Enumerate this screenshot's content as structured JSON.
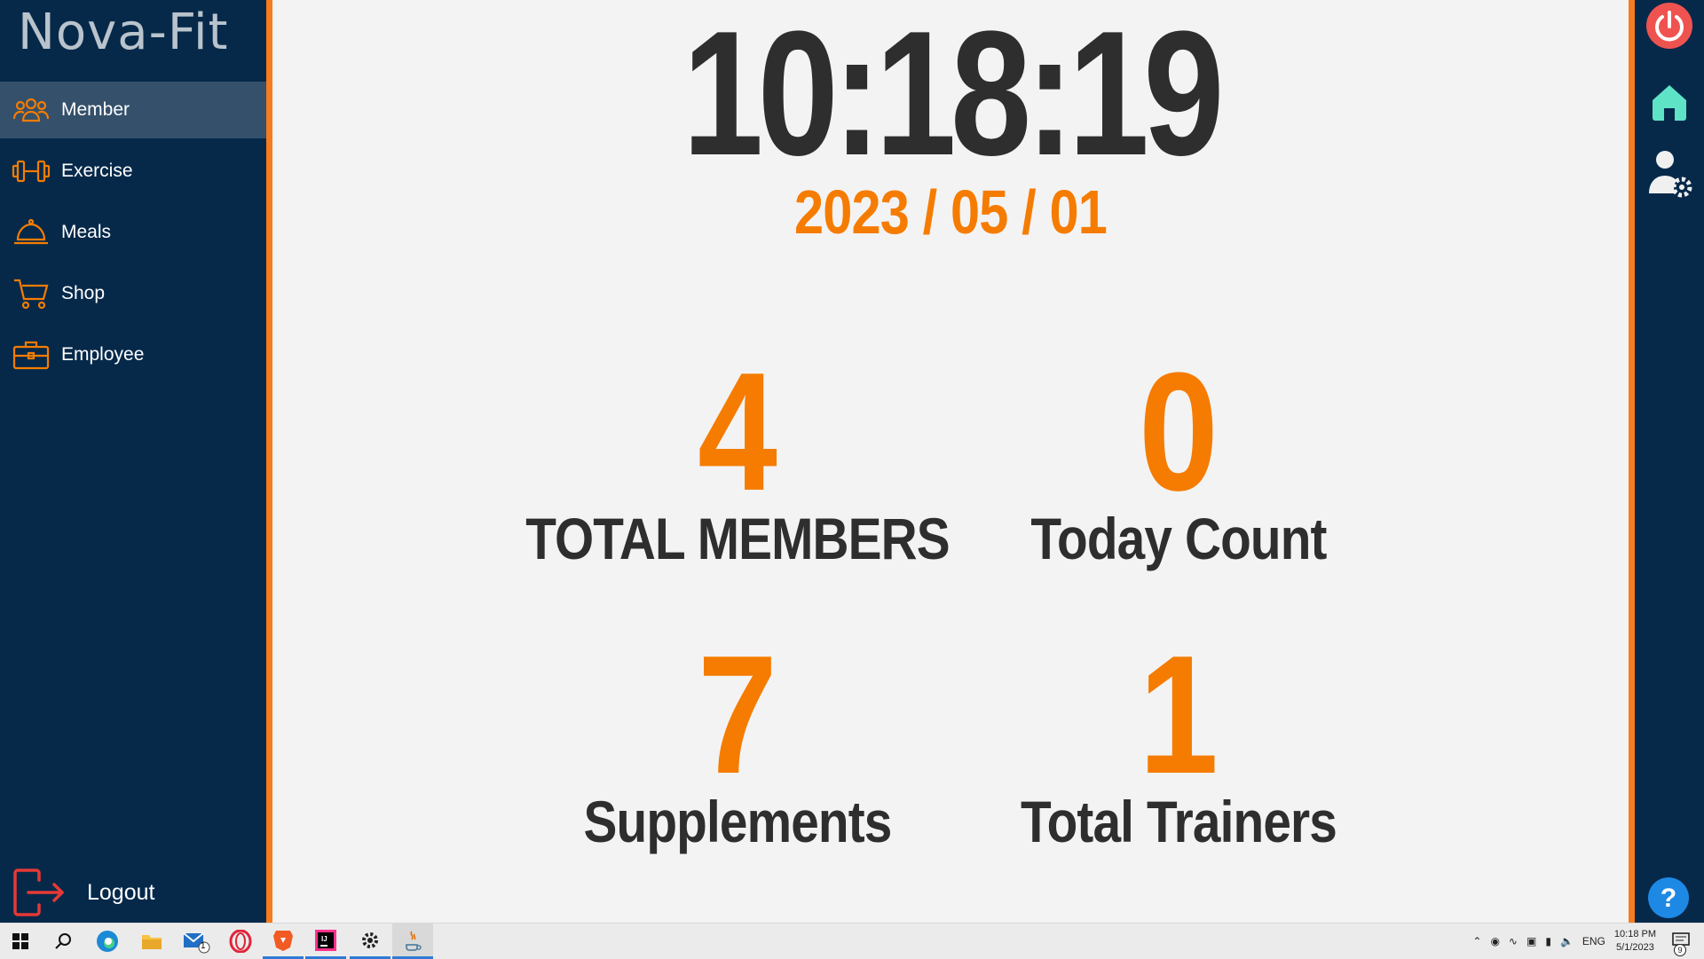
{
  "app": {
    "title": "Nova-Fit"
  },
  "sidebar": {
    "items": [
      {
        "label": "Member",
        "icon": "members-icon",
        "active": true
      },
      {
        "label": "Exercise",
        "icon": "dumbbell-icon",
        "active": false
      },
      {
        "label": "Meals",
        "icon": "cloche-icon",
        "active": false
      },
      {
        "label": "Shop",
        "icon": "cart-icon",
        "active": false
      },
      {
        "label": "Employee",
        "icon": "briefcase-icon",
        "active": false
      }
    ],
    "logout_label": "Logout"
  },
  "dashboard": {
    "time": "10:18:19",
    "date": "2023 / 05 / 01",
    "stats": [
      {
        "value": "4",
        "label": "TOTAL MEMBERS"
      },
      {
        "value": "0",
        "label": "Today Count"
      },
      {
        "value": "7",
        "label": "Supplements"
      },
      {
        "value": "1",
        "label": "Total Trainers"
      }
    ]
  },
  "right_rail": {
    "buttons": [
      "power-icon",
      "home-icon",
      "user-settings-icon",
      "help-icon"
    ]
  },
  "taskbar": {
    "apps": [
      "windows-start-icon",
      "search-icon",
      "edge-icon",
      "file-explorer-icon",
      "mail-icon",
      "opera-icon",
      "brave-icon",
      "intellij-icon",
      "settings-icon",
      "java-icon"
    ],
    "mail_badge": "1",
    "language": "ENG",
    "time": "10:18 PM",
    "date": "5/1/2023",
    "notification_count": "9"
  },
  "colors": {
    "sidebar_bg": "#06294a",
    "accent_orange": "#f57c00",
    "main_bg": "#f3f3f3",
    "text_dark": "#2e2e2e",
    "active_item_bg": "#34506b"
  }
}
